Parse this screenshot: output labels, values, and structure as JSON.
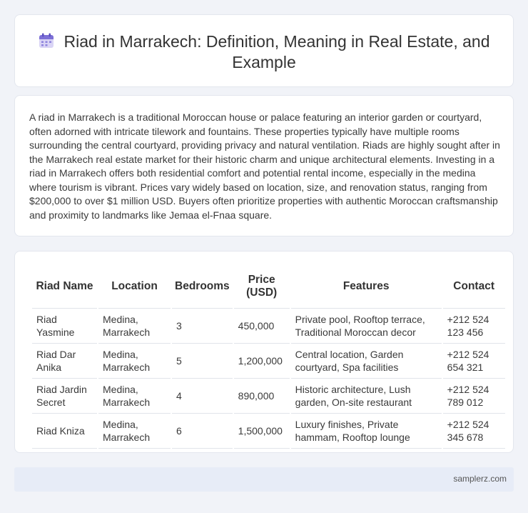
{
  "header": {
    "title": "Riad in Marrakech: Definition, Meaning in Real Estate, and Example",
    "icon": "calendar-icon"
  },
  "description": "A riad in Marrakech is a traditional Moroccan house or palace featuring an interior garden or courtyard, often adorned with intricate tilework and fountains. These properties typically have multiple rooms surrounding the central courtyard, providing privacy and natural ventilation. Riads are highly sought after in the Marrakech real estate market for their historic charm and unique architectural elements. Investing in a riad in Marrakech offers both residential comfort and potential rental income, especially in the medina where tourism is vibrant. Prices vary widely based on location, size, and renovation status, ranging from $200,000 to over $1 million USD. Buyers often prioritize properties with authentic Moroccan craftsmanship and proximity to landmarks like Jemaa el-Fnaa square.",
  "table": {
    "headers": [
      "Riad Name",
      "Location",
      "Bedrooms",
      "Price (USD)",
      "Features",
      "Contact"
    ],
    "rows": [
      [
        "Riad Yasmine",
        "Medina, Marrakech",
        "3",
        "450,000",
        "Private pool, Rooftop terrace, Traditional Moroccan decor",
        "+212 524 123 456"
      ],
      [
        "Riad Dar Anika",
        "Medina, Marrakech",
        "5",
        "1,200,000",
        "Central location, Garden courtyard, Spa facilities",
        "+212 524 654 321"
      ],
      [
        "Riad Jardin Secret",
        "Medina, Marrakech",
        "4",
        "890,000",
        "Historic architecture, Lush garden, On-site restaurant",
        "+212 524 789 012"
      ],
      [
        "Riad Kniza",
        "Medina, Marrakech",
        "6",
        "1,500,000",
        "Luxury finishes, Private hammam, Rooftop lounge",
        "+212 524 345 678"
      ]
    ]
  },
  "footer": {
    "site": "samplerz.com"
  }
}
